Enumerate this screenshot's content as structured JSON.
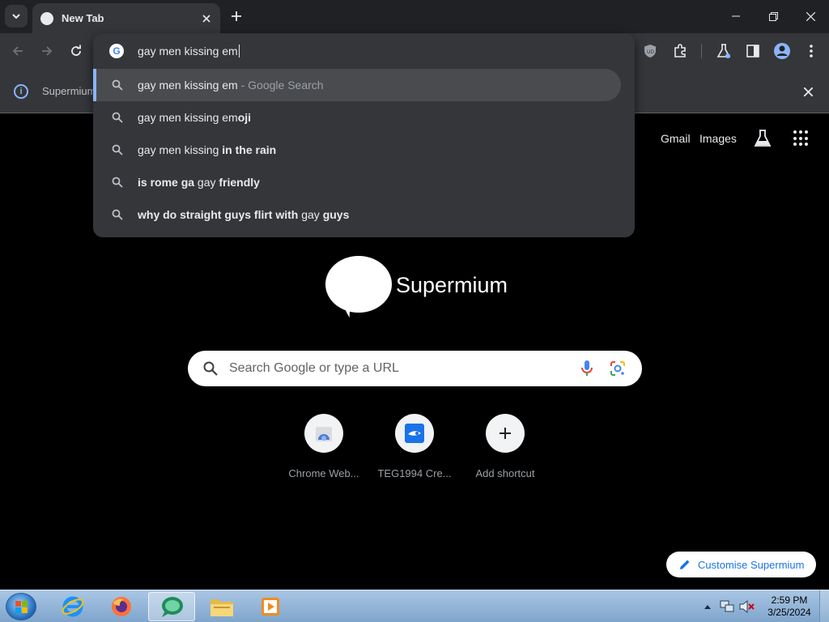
{
  "window": {
    "tab_title": "New Tab"
  },
  "infobar": {
    "text": "Supermium"
  },
  "omnibox": {
    "input_value": "gay men kissing em",
    "suggestions": [
      {
        "parts": [
          {
            "t": "gay men kissing em",
            "b": false
          },
          {
            "t": " - Google Search",
            "b": false,
            "dim": true
          }
        ]
      },
      {
        "parts": [
          {
            "t": "gay men kissing em",
            "b": false
          },
          {
            "t": "oji",
            "b": true
          }
        ]
      },
      {
        "parts": [
          {
            "t": "gay men kissing ",
            "b": false
          },
          {
            "t": "in the rain",
            "b": true
          }
        ]
      },
      {
        "parts": [
          {
            "t": "is rome ga ",
            "b": true
          },
          {
            "t": "gay",
            "b": false
          },
          {
            "t": " friendly",
            "b": true
          }
        ]
      },
      {
        "parts": [
          {
            "t": "why do straight guys flirt with ",
            "b": true
          },
          {
            "t": "gay",
            "b": false
          },
          {
            "t": " guys",
            "b": true
          }
        ]
      }
    ]
  },
  "ntp": {
    "gmail": "Gmail",
    "images": "Images",
    "logo_text": "Supermium",
    "search_placeholder": "Search Google or type a URL",
    "shortcuts": [
      {
        "label": "Chrome Web..."
      },
      {
        "label": "TEG1994 Cre..."
      },
      {
        "label": "Add shortcut"
      }
    ],
    "customise": "Customise Supermium"
  },
  "taskbar": {
    "time": "2:59 PM",
    "date": "3/25/2024"
  },
  "colors": {
    "accent": "#8ab4f8",
    "toolbar": "#35363a",
    "titlebar": "#202124"
  }
}
